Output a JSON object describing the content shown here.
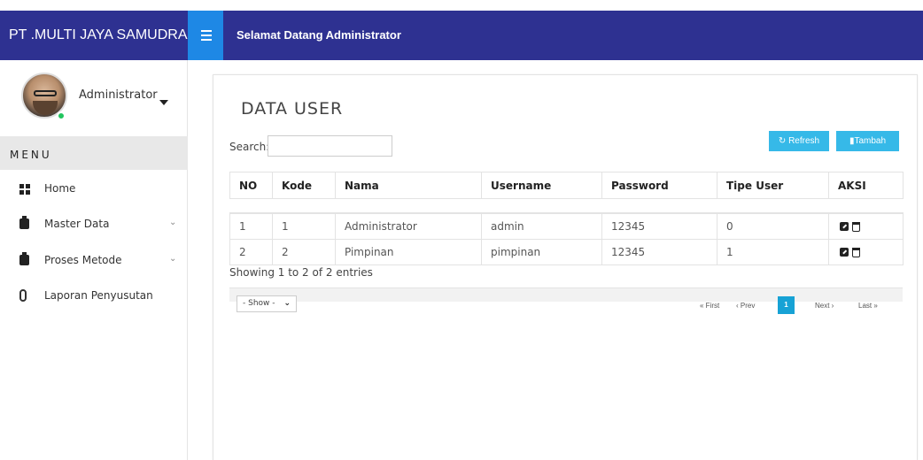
{
  "app": {
    "brand": "PT .MULTI JAYA SAMUDRA",
    "welcome": "Selamat Datang Administrator"
  },
  "sidebar": {
    "user_name": "Administrator",
    "menu_header": "MENU",
    "items": [
      {
        "label": "Home",
        "icon": "dashboard-icon",
        "has_submenu": false
      },
      {
        "label": "Master Data",
        "icon": "clipboard-icon",
        "has_submenu": true
      },
      {
        "label": "Proses Metode",
        "icon": "clipboard-icon",
        "has_submenu": true
      },
      {
        "label": "Laporan Penyusutan",
        "icon": "paperclip-icon",
        "has_submenu": false
      }
    ]
  },
  "main": {
    "title": "DATA  USER",
    "search_label": "Search:",
    "search_value": "",
    "buttons": {
      "refresh": "Refresh",
      "tambah": "Tambah"
    },
    "table": {
      "columns": [
        "NO",
        "Kode",
        "Nama",
        "Username",
        "Password",
        "Tipe User",
        "AKSI"
      ],
      "rows": [
        {
          "no": "1",
          "kode": "1",
          "nama": "Administrator",
          "username": "admin",
          "password": "12345",
          "tipe_user": "0"
        },
        {
          "no": "2",
          "kode": "2",
          "nama": "Pimpinan",
          "username": "pimpinan",
          "password": "12345",
          "tipe_user": "1"
        }
      ]
    },
    "showing": "Showing 1 to 2 of 2 entries",
    "page_size_select": "- Show -",
    "pagination": {
      "first": "« First",
      "prev": "‹ Prev",
      "current": "1",
      "next": "Next ›",
      "last": "Last »"
    }
  },
  "colors": {
    "topbar": "#2e3191",
    "toggle": "#1e88e5",
    "button": "#36b9e8",
    "active_page": "#17a2d5",
    "online": "#22c55e"
  }
}
